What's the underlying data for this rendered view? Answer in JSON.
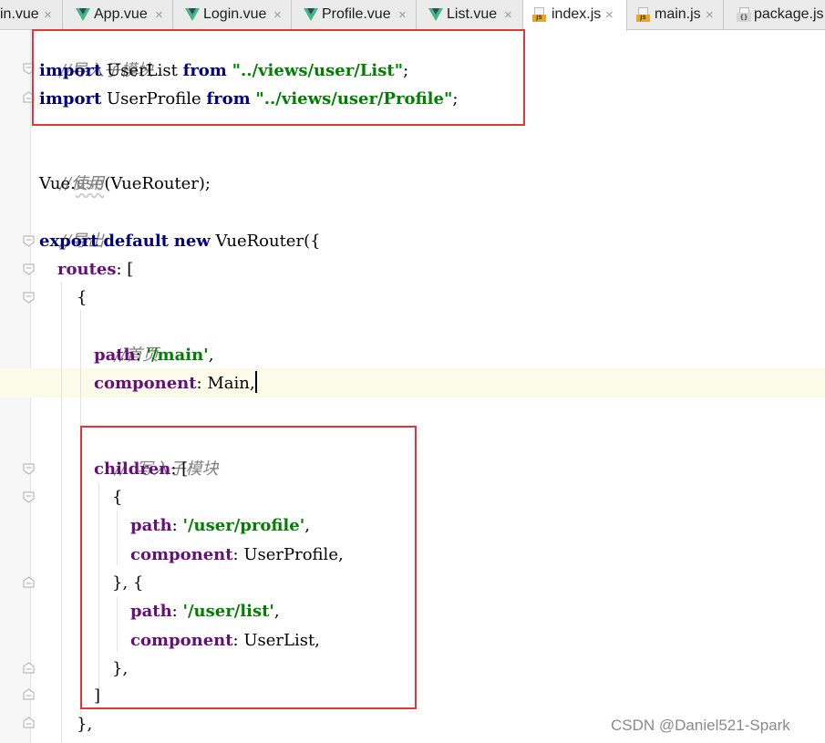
{
  "tabs": [
    {
      "label": "in.vue",
      "icon": "vue-icon",
      "active": false
    },
    {
      "label": "App.vue",
      "icon": "vue-icon",
      "active": false
    },
    {
      "label": "Login.vue",
      "icon": "vue-icon",
      "active": false
    },
    {
      "label": "Profile.vue",
      "icon": "vue-icon",
      "active": false
    },
    {
      "label": "List.vue",
      "icon": "vue-icon",
      "active": false
    },
    {
      "label": "index.js",
      "icon": "js-file-icon",
      "active": true
    },
    {
      "label": "main.js",
      "icon": "js-file-icon",
      "active": false
    },
    {
      "label": "package.js",
      "icon": "json-file-icon",
      "active": false
    }
  ],
  "tab_close": "×",
  "icon_badges": {
    "js": "JS",
    "json": "{}"
  },
  "code": {
    "l1": {
      "c": "//导入子模块"
    },
    "l2": {
      "k1": "import",
      "t1": " UserList ",
      "k2": "from",
      "t2": " ",
      "s": "\"../views/user/List\"",
      "t3": ";"
    },
    "l3": {
      "k1": "import",
      "t1": " UserProfile ",
      "k2": "from",
      "t2": " ",
      "s": "\"../views/user/Profile\"",
      "t3": ";"
    },
    "l4": {
      "c": "//使用"
    },
    "l5": {
      "t1": "Vue.",
      "f": "use",
      "t2": "(VueRouter);"
    },
    "l6": {
      "c": "//导出"
    },
    "l7": {
      "k1": "export",
      "t1": " ",
      "k2": "default",
      "t2": " ",
      "k3": "new",
      "t3": " VueRouter({"
    },
    "l8": {
      "p": "routes",
      "t1": ": ["
    },
    "l9": {
      "t1": "{"
    },
    "l10": {
      "c": "//首页"
    },
    "l11": {
      "p": "path",
      "t1": ": ",
      "s": "'/main'",
      "t2": ","
    },
    "l12": {
      "p": "component",
      "t1": ": Main,"
    },
    "l13": {
      "c": "//  写入子模块"
    },
    "l14": {
      "p": "children",
      "t1": ": ["
    },
    "l15": {
      "t1": "{"
    },
    "l16": {
      "p": "path",
      "t1": ": ",
      "s": "'/user/profile'",
      "t2": ","
    },
    "l17": {
      "p": "component",
      "t1": ": UserProfile,"
    },
    "l18": {
      "t1": "}, {"
    },
    "l19": {
      "p": "path",
      "t1": ": ",
      "s": "'/user/list'",
      "t2": ","
    },
    "l20": {
      "p": "component",
      "t1": ": UserList,"
    },
    "l21": {
      "t1": "},"
    },
    "l22": {
      "t1": "]"
    },
    "l23": {
      "t1": "},"
    }
  },
  "watermark": "CSDN @Daniel521-Spark",
  "colors": {
    "keyword": "#000080",
    "property": "#660e7a",
    "string": "#008000",
    "comment": "#808080",
    "annotation_box": "#e5343a",
    "caret_line": "#fcfae8"
  }
}
